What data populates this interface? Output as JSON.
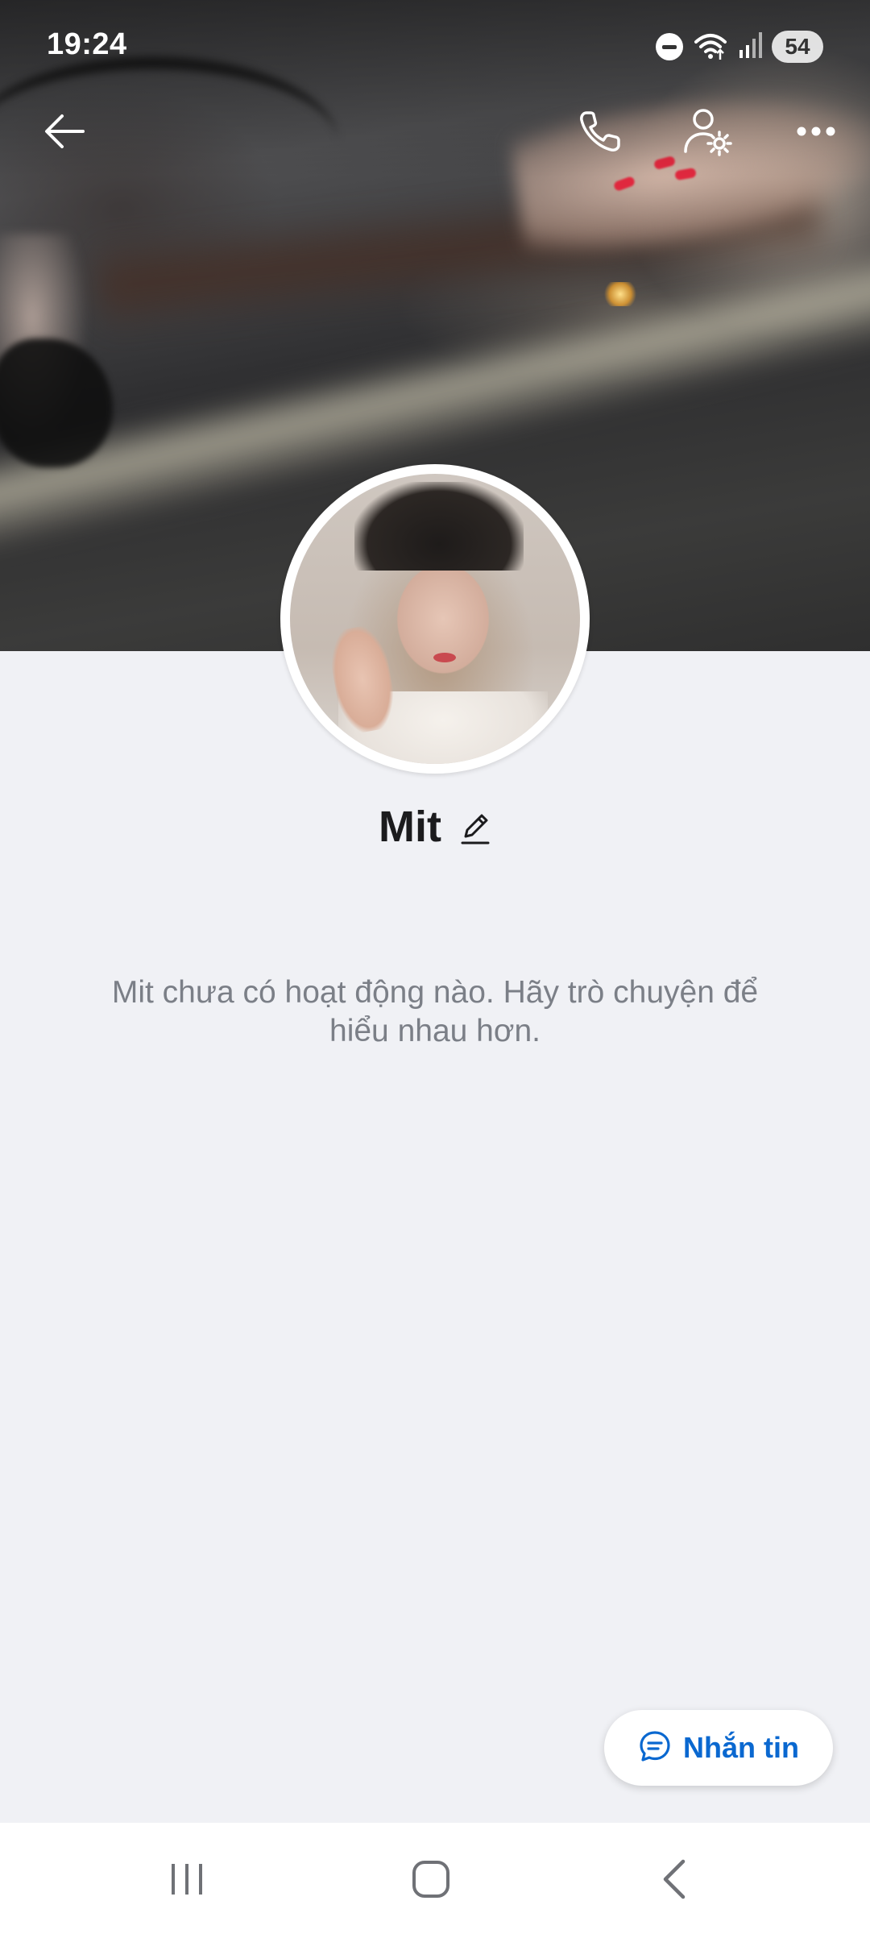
{
  "status_bar": {
    "time": "19:24",
    "battery": "54",
    "icons": [
      "do-not-disturb-icon",
      "wifi-icon",
      "signal-icon"
    ]
  },
  "top_bar": {
    "icons": [
      "back-arrow-icon",
      "phone-icon",
      "user-settings-icon",
      "more-icon"
    ]
  },
  "profile": {
    "name": "Mit",
    "empty_message": "Mit chưa có hoạt động nào. Hãy trò chuyện để hiểu nhau hơn."
  },
  "message_button": {
    "label": "Nhắn tin",
    "icon": "chat-bubble-icon"
  },
  "nav_bar": {
    "icons": [
      "recent-apps-icon",
      "home-icon",
      "back-icon"
    ]
  },
  "colors": {
    "accent": "#0a68d0",
    "background": "#f0f1f5",
    "name_text": "#1b1b1d",
    "secondary_text": "#7b7f87"
  }
}
